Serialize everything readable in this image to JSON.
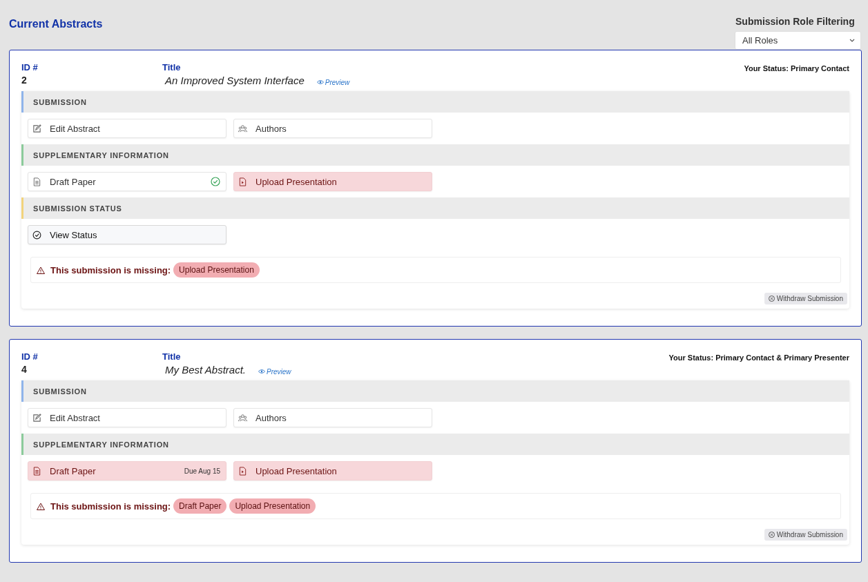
{
  "page_title": "Current Abstracts",
  "filter": {
    "label": "Submission Role Filtering",
    "value": "All Roles"
  },
  "abstracts": [
    {
      "id_label": "ID #",
      "id": "2",
      "title_label": "Title",
      "title": "An Improved System Interface",
      "preview": "Preview",
      "your_status_label": "Your Status:",
      "your_status": "Primary Contact",
      "sections": [
        {
          "heading": "SUBMISSION",
          "color": "#8fb4ea",
          "tiles": [
            {
              "kind": "edit",
              "label": "Edit Abstract",
              "complete": false,
              "missing": false
            },
            {
              "kind": "authors",
              "label": "Authors",
              "complete": false,
              "missing": false
            }
          ]
        },
        {
          "heading": "SUPPLEMENTARY INFORMATION",
          "color": "#8ccb9b",
          "tiles": [
            {
              "kind": "document",
              "label": "Draft Paper",
              "complete": true,
              "missing": false
            },
            {
              "kind": "presentation",
              "label": "Upload Presentation",
              "complete": false,
              "missing": true
            }
          ]
        },
        {
          "heading": "SUBMISSION STATUS",
          "color": "#f2d37c",
          "tiles": [
            {
              "kind": "status",
              "label": "View Status",
              "complete": false,
              "missing": false
            }
          ]
        }
      ],
      "missing_label": "This submission is missing:",
      "missing": [
        "Upload Presentation"
      ],
      "withdraw": "Withdraw Submission"
    },
    {
      "id_label": "ID #",
      "id": "4",
      "title_label": "Title",
      "title": "My Best Abstract.",
      "preview": "Preview",
      "your_status_label": "Your Status:",
      "your_status": "Primary Contact & Primary Presenter",
      "sections": [
        {
          "heading": "SUBMISSION",
          "color": "#8fb4ea",
          "tiles": [
            {
              "kind": "edit",
              "label": "Edit Abstract",
              "complete": false,
              "missing": false
            },
            {
              "kind": "authors",
              "label": "Authors",
              "complete": false,
              "missing": false
            }
          ]
        },
        {
          "heading": "SUPPLEMENTARY INFORMATION",
          "color": "#8ccb9b",
          "tiles": [
            {
              "kind": "document",
              "label": "Draft Paper",
              "complete": false,
              "missing": true,
              "due": "Due Aug 15"
            },
            {
              "kind": "presentation",
              "label": "Upload Presentation",
              "complete": false,
              "missing": true
            }
          ]
        }
      ],
      "missing_label": "This submission is missing:",
      "missing": [
        "Draft Paper",
        "Upload Presentation"
      ],
      "withdraw": "Withdraw Submission"
    }
  ]
}
